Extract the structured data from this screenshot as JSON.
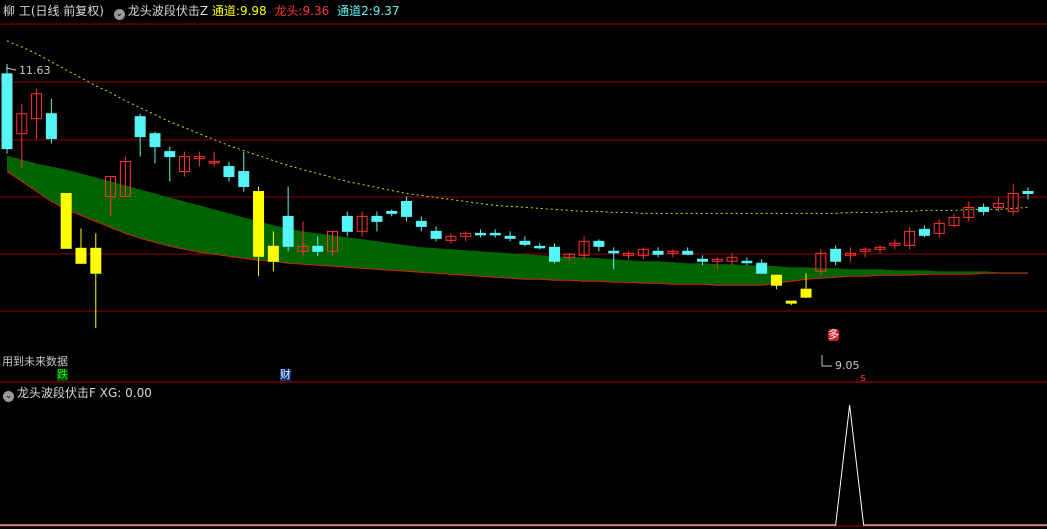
{
  "header": {
    "stock": "柳 工(日线 前复权)",
    "indicator": "龙头波段伏击Z",
    "ch1_label": "通道:",
    "ch1_value": "9.98",
    "lt_label": "龙头:",
    "lt_value": "9.36",
    "ch2_label": "通道2:",
    "ch2_value": "9.37",
    "chevron_icon": "chevron-down-icon"
  },
  "sub_header": {
    "indicator": "龙头波段伏击F",
    "xg_label": "XG:",
    "xg_value": "0.00"
  },
  "annotations": {
    "high_price": "11.63",
    "low_price": "9.05",
    "future_data_note": "用到未来数据",
    "tag_die": "跌",
    "tag_cai": "财",
    "tag_duo": "多",
    "tag_s": "s"
  },
  "colors": {
    "up": "#ff3333",
    "down": "#55f5f5",
    "yellow": "#ffff00",
    "band_fill": "#006400",
    "band_edge": "#cc2222",
    "grid": "#8b0000",
    "dotted": "#e0e000"
  },
  "chart_data": {
    "type": "candlestick",
    "price_range": [
      8.8,
      12.1
    ],
    "grid": true,
    "candles": [
      {
        "o": 11.6,
        "h": 11.7,
        "l": 10.8,
        "c": 10.85,
        "k": "d"
      },
      {
        "o": 11.0,
        "h": 11.3,
        "l": 10.65,
        "c": 11.2,
        "k": "u"
      },
      {
        "o": 11.15,
        "h": 11.45,
        "l": 10.95,
        "c": 11.4,
        "k": "u"
      },
      {
        "o": 11.2,
        "h": 11.35,
        "l": 10.9,
        "c": 10.95,
        "k": "d"
      },
      {
        "o": 10.4,
        "h": 10.4,
        "l": 9.85,
        "c": 9.85,
        "k": "y"
      },
      {
        "o": 9.85,
        "h": 10.05,
        "l": 9.7,
        "c": 9.7,
        "k": "y"
      },
      {
        "o": 9.85,
        "h": 10.0,
        "l": 9.05,
        "c": 9.6,
        "k": "y"
      },
      {
        "o": 10.37,
        "h": 10.57,
        "l": 10.17,
        "c": 10.57,
        "k": "u"
      },
      {
        "o": 10.37,
        "h": 10.77,
        "l": 10.37,
        "c": 10.72,
        "k": "u"
      },
      {
        "o": 11.17,
        "h": 11.2,
        "l": 10.77,
        "c": 10.97,
        "k": "d"
      },
      {
        "o": 11.0,
        "h": 11.02,
        "l": 10.7,
        "c": 10.87,
        "k": "d"
      },
      {
        "o": 10.82,
        "h": 10.87,
        "l": 10.52,
        "c": 10.77,
        "k": "d"
      },
      {
        "o": 10.62,
        "h": 10.82,
        "l": 10.57,
        "c": 10.77,
        "k": "u"
      },
      {
        "o": 10.77,
        "h": 10.82,
        "l": 10.67,
        "c": 10.75,
        "k": "u"
      },
      {
        "o": 10.72,
        "h": 10.82,
        "l": 10.67,
        "c": 10.72,
        "k": "u"
      },
      {
        "o": 10.67,
        "h": 10.72,
        "l": 10.52,
        "c": 10.57,
        "k": "d"
      },
      {
        "o": 10.62,
        "h": 10.82,
        "l": 10.42,
        "c": 10.47,
        "k": "d"
      },
      {
        "o": 10.42,
        "h": 10.47,
        "l": 9.57,
        "c": 9.77,
        "k": "y"
      },
      {
        "o": 9.87,
        "h": 10.02,
        "l": 9.62,
        "c": 9.72,
        "k": "y"
      },
      {
        "o": 10.17,
        "h": 10.47,
        "l": 9.82,
        "c": 9.87,
        "k": "d"
      },
      {
        "o": 9.87,
        "h": 10.12,
        "l": 9.77,
        "c": 9.82,
        "k": "u"
      },
      {
        "o": 9.87,
        "h": 9.97,
        "l": 9.77,
        "c": 9.82,
        "k": "d"
      },
      {
        "o": 9.82,
        "h": 10.02,
        "l": 9.77,
        "c": 10.02,
        "k": "u"
      },
      {
        "o": 10.17,
        "h": 10.22,
        "l": 9.97,
        "c": 10.02,
        "k": "d"
      },
      {
        "o": 10.02,
        "h": 10.22,
        "l": 9.97,
        "c": 10.17,
        "k": "u"
      },
      {
        "o": 10.17,
        "h": 10.22,
        "l": 10.02,
        "c": 10.12,
        "k": "d"
      },
      {
        "o": 10.22,
        "h": 10.24,
        "l": 10.17,
        "c": 10.2,
        "k": "d"
      },
      {
        "o": 10.32,
        "h": 10.37,
        "l": 10.12,
        "c": 10.17,
        "k": "d"
      },
      {
        "o": 10.12,
        "h": 10.17,
        "l": 10.02,
        "c": 10.07,
        "k": "d"
      },
      {
        "o": 10.02,
        "h": 10.07,
        "l": 9.92,
        "c": 9.95,
        "k": "d"
      },
      {
        "o": 9.93,
        "h": 10.0,
        "l": 9.9,
        "c": 9.97,
        "k": "u"
      },
      {
        "o": 9.97,
        "h": 10.02,
        "l": 9.92,
        "c": 10.0,
        "k": "u"
      },
      {
        "o": 10.0,
        "h": 10.04,
        "l": 9.96,
        "c": 9.99,
        "k": "d"
      },
      {
        "o": 10.0,
        "h": 10.04,
        "l": 9.96,
        "c": 9.99,
        "k": "d"
      },
      {
        "o": 9.97,
        "h": 10.02,
        "l": 9.92,
        "c": 9.95,
        "k": "d"
      },
      {
        "o": 9.92,
        "h": 9.97,
        "l": 9.87,
        "c": 9.89,
        "k": "d"
      },
      {
        "o": 9.87,
        "h": 9.9,
        "l": 9.84,
        "c": 9.86,
        "k": "d"
      },
      {
        "o": 9.86,
        "h": 9.9,
        "l": 9.7,
        "c": 9.72,
        "k": "d"
      },
      {
        "o": 9.76,
        "h": 9.8,
        "l": 9.72,
        "c": 9.79,
        "k": "u"
      },
      {
        "o": 9.78,
        "h": 9.97,
        "l": 9.74,
        "c": 9.92,
        "k": "u"
      },
      {
        "o": 9.92,
        "h": 9.94,
        "l": 9.82,
        "c": 9.87,
        "k": "d"
      },
      {
        "o": 9.82,
        "h": 9.86,
        "l": 9.64,
        "c": 9.81,
        "k": "d"
      },
      {
        "o": 9.78,
        "h": 9.82,
        "l": 9.74,
        "c": 9.8,
        "k": "u"
      },
      {
        "o": 9.78,
        "h": 9.86,
        "l": 9.74,
        "c": 9.84,
        "k": "u"
      },
      {
        "o": 9.82,
        "h": 9.86,
        "l": 9.76,
        "c": 9.79,
        "k": "d"
      },
      {
        "o": 9.8,
        "h": 9.84,
        "l": 9.76,
        "c": 9.82,
        "k": "u"
      },
      {
        "o": 9.82,
        "h": 9.86,
        "l": 9.78,
        "c": 9.79,
        "k": "d"
      },
      {
        "o": 9.74,
        "h": 9.78,
        "l": 9.68,
        "c": 9.72,
        "k": "d"
      },
      {
        "o": 9.72,
        "h": 9.76,
        "l": 9.64,
        "c": 9.74,
        "k": "u"
      },
      {
        "o": 9.72,
        "h": 9.8,
        "l": 9.68,
        "c": 9.76,
        "k": "u"
      },
      {
        "o": 9.72,
        "h": 9.76,
        "l": 9.68,
        "c": 9.72,
        "k": "d"
      },
      {
        "o": 9.7,
        "h": 9.74,
        "l": 9.6,
        "c": 9.6,
        "k": "d"
      },
      {
        "o": 9.58,
        "h": 9.58,
        "l": 9.44,
        "c": 9.48,
        "k": "y"
      },
      {
        "o": 9.32,
        "h": 9.32,
        "l": 9.28,
        "c": 9.3,
        "k": "y"
      },
      {
        "o": 9.36,
        "h": 9.6,
        "l": 9.35,
        "c": 9.44,
        "k": "y"
      },
      {
        "o": 9.62,
        "h": 9.84,
        "l": 9.58,
        "c": 9.8,
        "k": "u"
      },
      {
        "o": 9.72,
        "h": 9.88,
        "l": 9.68,
        "c": 9.84,
        "k": "d"
      },
      {
        "o": 9.78,
        "h": 9.86,
        "l": 9.72,
        "c": 9.8,
        "k": "u"
      },
      {
        "o": 9.82,
        "h": 9.86,
        "l": 9.76,
        "c": 9.84,
        "k": "u"
      },
      {
        "o": 9.84,
        "h": 9.88,
        "l": 9.8,
        "c": 9.86,
        "k": "u"
      },
      {
        "o": 9.88,
        "h": 9.94,
        "l": 9.84,
        "c": 9.9,
        "k": "u"
      },
      {
        "o": 9.88,
        "h": 10.06,
        "l": 9.84,
        "c": 10.02,
        "k": "u"
      },
      {
        "o": 9.98,
        "h": 10.08,
        "l": 9.96,
        "c": 10.04,
        "k": "d"
      },
      {
        "o": 10.0,
        "h": 10.14,
        "l": 9.96,
        "c": 10.1,
        "k": "u"
      },
      {
        "o": 10.08,
        "h": 10.2,
        "l": 10.06,
        "c": 10.16,
        "k": "u"
      },
      {
        "o": 10.16,
        "h": 10.32,
        "l": 10.12,
        "c": 10.26,
        "k": "u"
      },
      {
        "o": 10.26,
        "h": 10.3,
        "l": 10.18,
        "c": 10.22,
        "k": "d"
      },
      {
        "o": 10.26,
        "h": 10.36,
        "l": 10.22,
        "c": 10.3,
        "k": "u"
      },
      {
        "o": 10.22,
        "h": 10.5,
        "l": 10.18,
        "c": 10.4,
        "k": "u"
      },
      {
        "o": 10.4,
        "h": 10.46,
        "l": 10.34,
        "c": 10.42,
        "k": "d"
      }
    ],
    "band_top": [
      10.78,
      10.74,
      10.7,
      10.67,
      10.64,
      10.6,
      10.56,
      10.52,
      10.48,
      10.44,
      10.4,
      10.36,
      10.32,
      10.28,
      10.24,
      10.2,
      10.16,
      10.12,
      10.08,
      10.05,
      10.02,
      10.0,
      9.98,
      9.96,
      9.94,
      9.92,
      9.9,
      9.88,
      9.86,
      9.85,
      9.84,
      9.83,
      9.82,
      9.81,
      9.8,
      9.79,
      9.78,
      9.77,
      9.76,
      9.76,
      9.75,
      9.74,
      9.73,
      9.72,
      9.72,
      9.71,
      9.7,
      9.7,
      9.69,
      9.69,
      9.68,
      9.68,
      9.67,
      9.66,
      9.66,
      9.65,
      9.65,
      9.64,
      9.64,
      9.64,
      9.63,
      9.63,
      9.63,
      9.62,
      9.62,
      9.62,
      9.62,
      9.61,
      9.61,
      9.61
    ],
    "band_bottom": [
      10.62,
      10.52,
      10.42,
      10.32,
      10.24,
      10.18,
      10.12,
      10.06,
      10.0,
      9.95,
      9.91,
      9.87,
      9.84,
      9.81,
      9.79,
      9.77,
      9.75,
      9.73,
      9.72,
      9.7,
      9.69,
      9.68,
      9.67,
      9.66,
      9.65,
      9.64,
      9.63,
      9.62,
      9.61,
      9.6,
      9.59,
      9.58,
      9.57,
      9.56,
      9.55,
      9.54,
      9.54,
      9.53,
      9.53,
      9.52,
      9.52,
      9.51,
      9.51,
      9.5,
      9.5,
      9.49,
      9.49,
      9.49,
      9.48,
      9.48,
      9.48,
      9.48,
      9.5,
      9.52,
      9.54,
      9.55,
      9.56,
      9.57,
      9.57,
      9.58,
      9.58,
      9.58,
      9.59,
      9.59,
      9.59,
      9.59,
      9.6,
      9.6,
      9.6,
      9.6
    ],
    "dotted_line": [
      11.93,
      11.87,
      11.8,
      11.72,
      11.64,
      11.56,
      11.48,
      11.41,
      11.33,
      11.26,
      11.19,
      11.12,
      11.06,
      11.0,
      10.94,
      10.88,
      10.83,
      10.78,
      10.73,
      10.68,
      10.64,
      10.6,
      10.56,
      10.52,
      10.49,
      10.46,
      10.43,
      10.4,
      10.38,
      10.36,
      10.34,
      10.32,
      10.3,
      10.28,
      10.27,
      10.26,
      10.25,
      10.24,
      10.23,
      10.22,
      10.22,
      10.21,
      10.21,
      10.2,
      10.2,
      10.2,
      10.2,
      10.2,
      10.2,
      10.2,
      10.2,
      10.2,
      10.2,
      10.2,
      10.2,
      10.2,
      10.2,
      10.21,
      10.21,
      10.21,
      10.22,
      10.22,
      10.23,
      10.23,
      10.23,
      10.24,
      10.24,
      10.24,
      10.25,
      10.26
    ],
    "xg_signal": {
      "index": 56,
      "value": 1,
      "range": [
        0,
        1
      ]
    }
  }
}
